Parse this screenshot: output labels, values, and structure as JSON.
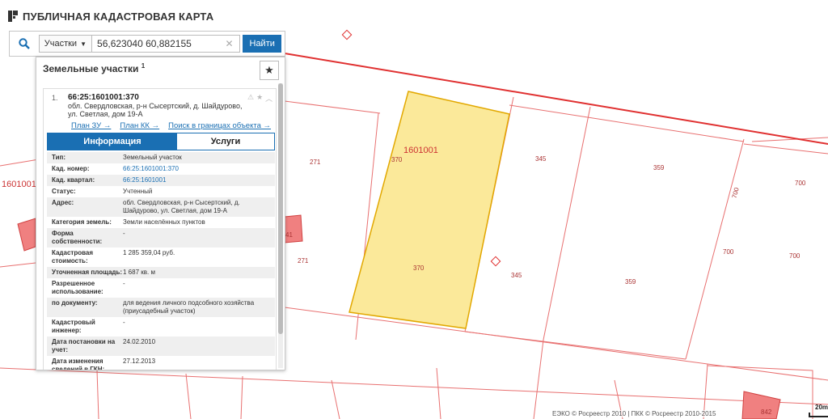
{
  "app": {
    "title": "ПУБЛИЧНАЯ КАДАСТРОВАЯ КАРТА"
  },
  "search": {
    "type_label": "Участки",
    "query": "56,623040 60,882155",
    "find_label": "Найти"
  },
  "panel": {
    "title": "Земельные участки",
    "count": "1",
    "item": {
      "index": "1.",
      "cad_number": "66:25:1601001:370",
      "address_line1": "обл. Свердловская, р-н Сысертский, д. Шайдурово,",
      "address_line2": "ул. Светлая, дом 19-А",
      "links": {
        "plan_zu": "План ЗУ →",
        "plan_kk": "План КК →",
        "search_bounds": "Поиск в границах объекта →"
      },
      "tabs": {
        "info": "Информация",
        "services": "Услуги"
      },
      "info": [
        {
          "key": "Тип:",
          "value": "Земельный участок"
        },
        {
          "key": "Кад. номер:",
          "value": "66:25:1601001:370",
          "link": true
        },
        {
          "key": "Кад. квартал:",
          "value": "66:25:1601001",
          "link": true
        },
        {
          "key": "Статус:",
          "value": "Учтенный"
        },
        {
          "key": "Адрес:",
          "value": "обл. Свердловская, р-н Сысертский, д. Шайдурово, ул. Светлая, дом 19-А"
        },
        {
          "key": "Категория земель:",
          "value": "Земли населённых пунктов"
        },
        {
          "key": "Форма собственности:",
          "value": "-"
        },
        {
          "key": "Кадастровая стоимость:",
          "value": "1 285 359,04 руб."
        },
        {
          "key": "Уточненная площадь:",
          "value": "1 687 кв. м"
        },
        {
          "key": "Разрешенное использование:",
          "value": "-"
        },
        {
          "key": "по документу:",
          "value": "для ведения личного подсобного хозяйства (приусадебный участок)"
        },
        {
          "key": "Кадастровый инженер:",
          "value": "-"
        },
        {
          "key": "Дата постановки на учет:",
          "value": "24.02.2010"
        },
        {
          "key": "Дата изменения сведений в ГКН:",
          "value": "27.12.2013"
        }
      ]
    }
  },
  "map": {
    "quarter_labels": [
      "1601001",
      "1601001"
    ],
    "parcel_labels": [
      "370",
      "370",
      "345",
      "345",
      "359",
      "359",
      "700",
      "700",
      "700",
      "700",
      "271",
      "271",
      "41",
      "842"
    ],
    "colors": {
      "selected_fill": "#fbe99a",
      "selected_stroke": "#e2a800",
      "boundary": "#e03030",
      "building": "#f08080"
    }
  },
  "footer": {
    "attribution": "ЕЭКО © Росреестр 2010 | ПКК © Росреестр 2010-2015",
    "scale": "20m"
  }
}
